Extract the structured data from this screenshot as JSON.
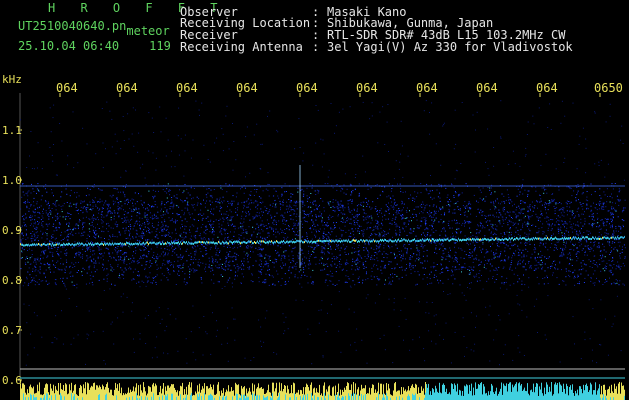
{
  "header": {
    "product": "H R O F F T",
    "filename": "UT2510040640.pn",
    "meteor_label": "meteor",
    "datetime": "25.10.04 06:40",
    "count": "119"
  },
  "info": {
    "rows": [
      {
        "label": "Observer",
        "value": "Masaki Kano"
      },
      {
        "label": "Receiving Location",
        "value": "Shibukawa, Gunma, Japan"
      },
      {
        "label": "Receiver",
        "value": "RTL-SDR SDR# 43dB L15 103.2MHz CW"
      },
      {
        "label": "Receiving Antenna",
        "value": "3el Yagi(V) Az 330 for Vladivostok"
      }
    ],
    "separator": ":"
  },
  "axis": {
    "unit": "kHz",
    "time_ticks": [
      "064",
      "064",
      "064",
      "064",
      "064",
      "064",
      "064",
      "064",
      "064",
      "0650"
    ],
    "freq_ticks": [
      "1.1",
      "1.0",
      "0.9",
      "0.8",
      "0.7",
      "0.6"
    ]
  },
  "colors": {
    "background": "#000000",
    "text_green": "#5fd35f",
    "text_white": "#e6e6e6",
    "tick_yellow": "#e8e05a",
    "noise_blue": "#1a2fd8",
    "signal_cyan": "#3fd0e0",
    "peak_yellow": "#e8e05a"
  }
}
